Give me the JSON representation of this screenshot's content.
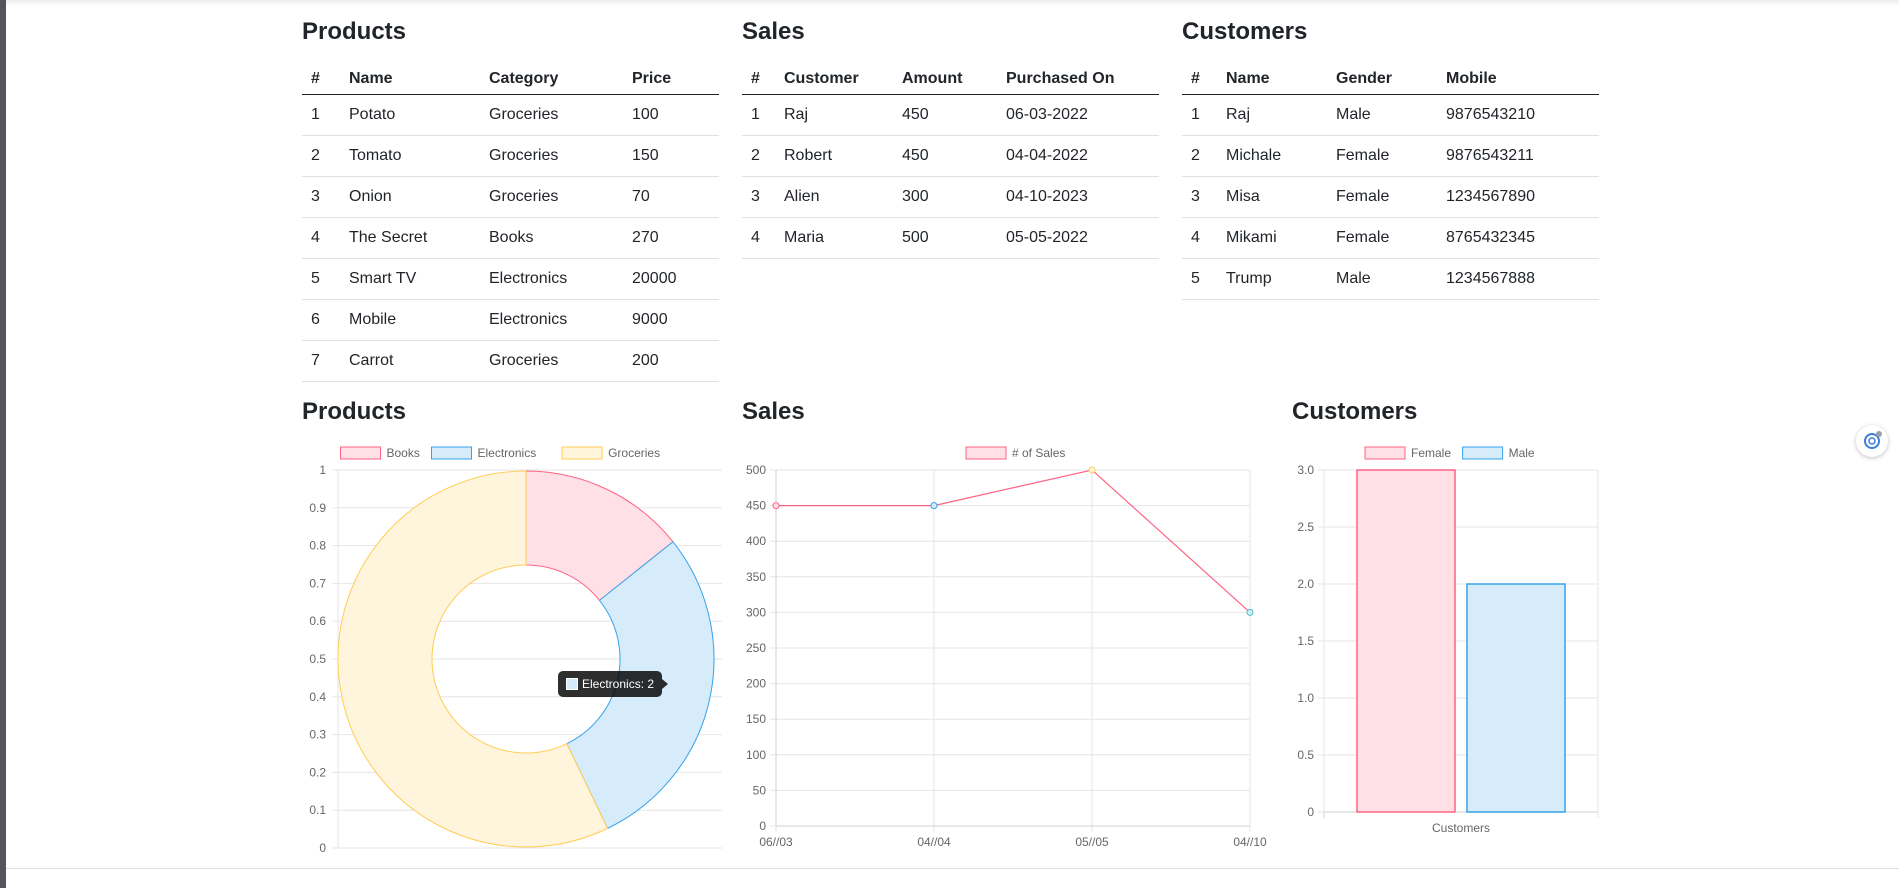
{
  "tables": {
    "products": {
      "title": "Products",
      "headers": [
        "#",
        "Name",
        "Category",
        "Price"
      ],
      "rows": [
        [
          "1",
          "Potato",
          "Groceries",
          "100"
        ],
        [
          "2",
          "Tomato",
          "Groceries",
          "150"
        ],
        [
          "3",
          "Onion",
          "Groceries",
          "70"
        ],
        [
          "4",
          "The Secret",
          "Books",
          "270"
        ],
        [
          "5",
          "Smart TV",
          "Electronics",
          "20000"
        ],
        [
          "6",
          "Mobile",
          "Electronics",
          "9000"
        ],
        [
          "7",
          "Carrot",
          "Groceries",
          "200"
        ]
      ]
    },
    "sales": {
      "title": "Sales",
      "headers": [
        "#",
        "Customer",
        "Amount",
        "Purchased On"
      ],
      "rows": [
        [
          "1",
          "Raj",
          "450",
          "06-03-2022"
        ],
        [
          "2",
          "Robert",
          "450",
          "04-04-2022"
        ],
        [
          "3",
          "Alien",
          "300",
          "04-10-2023"
        ],
        [
          "4",
          "Maria",
          "500",
          "05-05-2022"
        ]
      ]
    },
    "customers": {
      "title": "Customers",
      "headers": [
        "#",
        "Name",
        "Gender",
        "Mobile"
      ],
      "rows": [
        [
          "1",
          "Raj",
          "Male",
          "9876543210"
        ],
        [
          "2",
          "Michale",
          "Female",
          "9876543211"
        ],
        [
          "3",
          "Misa",
          "Female",
          "1234567890"
        ],
        [
          "4",
          "Mikami",
          "Female",
          "8765432345"
        ],
        [
          "5",
          "Trump",
          "Male",
          "1234567888"
        ]
      ]
    }
  },
  "charts": {
    "products_title": "Products",
    "sales_title": "Sales",
    "customers_title": "Customers",
    "tooltip": {
      "label": "Electronics: 2"
    }
  },
  "colors": {
    "pink_border": "#ff6384",
    "pink_fill": "#ffe0e6",
    "blue_border": "#36a2eb",
    "blue_fill": "#d7ecfb",
    "yellow_border": "#ffcd56",
    "yellow_fill": "#fff5dd",
    "teal_border": "#4bc0c0"
  },
  "chart_data": [
    {
      "type": "pie",
      "title": "",
      "categories": [
        "Books",
        "Electronics",
        "Groceries"
      ],
      "values": [
        1,
        2,
        4
      ],
      "yticks": [
        "0",
        "0.1",
        "0.2",
        "0.3",
        "0.4",
        "0.5",
        "0.6",
        "0.7",
        "0.8",
        "0.9",
        "1"
      ],
      "ylim": [
        0,
        1
      ],
      "legend": "top"
    },
    {
      "type": "line",
      "title": "",
      "series": [
        {
          "name": "# of Sales",
          "values": [
            450,
            450,
            500,
            300
          ]
        }
      ],
      "categories": [
        "06//03",
        "04//04",
        "05//05",
        "04//10"
      ],
      "ylim": [
        0,
        500
      ],
      "yticks": [
        "0",
        "50",
        "100",
        "150",
        "200",
        "250",
        "300",
        "350",
        "400",
        "450",
        "500"
      ],
      "grid": true,
      "legend": "top"
    },
    {
      "type": "bar",
      "title": "",
      "categories": [
        "Customers"
      ],
      "series": [
        {
          "name": "Female",
          "values": [
            3
          ]
        },
        {
          "name": "Male",
          "values": [
            2
          ]
        }
      ],
      "ylim": [
        0,
        3
      ],
      "yticks": [
        "0",
        "0.5",
        "1.0",
        "1.5",
        "2.0",
        "2.5",
        "3.0"
      ],
      "grid": true,
      "legend": "top"
    }
  ]
}
